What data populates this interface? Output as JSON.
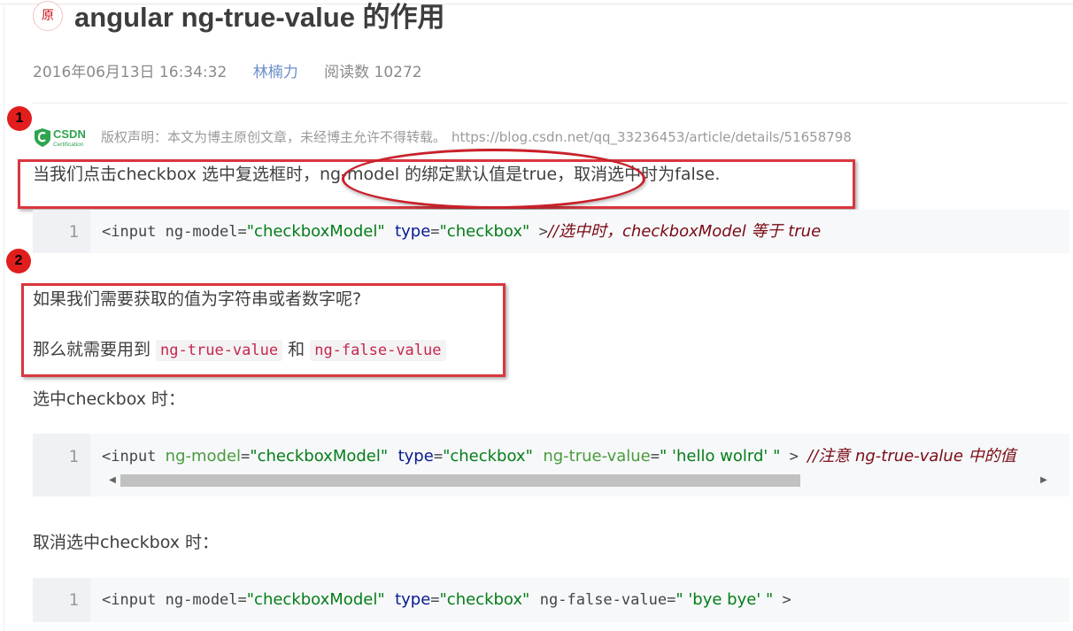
{
  "article": {
    "badge": "原",
    "title": "angular ng-true-value 的作用",
    "date": "2016年06月13日 16:34:32",
    "author": "林楠力",
    "views": "阅读数 10272"
  },
  "annotations": {
    "one": "1",
    "two": "2"
  },
  "copyright": {
    "logo_text": "CSDN",
    "logo_sub": "Certification",
    "text": "版权声明：本文为博主原创文章，未经博主允许不得转载。",
    "url": "https://blog.csdn.net/qq_33236453/article/details/51658798"
  },
  "paragraphs": {
    "p1_before": "当我们点击checkbox 选中复选框时，",
    "p1_highlight": "ng-model 的绑定默认值是true，",
    "p1_after": "取消选中时为false.",
    "p2": "如果我们需要获取的值为字符串或者数字呢?",
    "p3_before": "那么就需要用到 ",
    "p3_code1": "ng-true-value",
    "p3_mid": " 和 ",
    "p3_code2": "ng-false-value",
    "checked_heading": "选中checkbox 时：",
    "unchecked_heading": "取消选中checkbox 时："
  },
  "code_blocks": [
    {
      "line_number": "1",
      "t1": "<input ng-model=",
      "s1": "\"checkboxModel\"",
      "k1": "type",
      "t2": "=",
      "s2": "\"checkbox\"",
      "t3": " >",
      "comment": "//选中时，checkboxModel 等于 true"
    },
    {
      "line_number": "1",
      "t1": "<input ",
      "a1": "ng-model",
      "t2": "=",
      "s1": "\"checkboxModel\"",
      "k1": "type",
      "t3": "=",
      "s2": "\"checkbox\"",
      "a2": "ng-true-value",
      "t4": "=",
      "s3": "\" 'hello wolrd' \"",
      "t5": " > ",
      "comment": "//注意 ng-true-value 中的值"
    },
    {
      "line_number": "1",
      "t1": "<input ng-model=",
      "s1": "\"checkboxModel\"",
      "k1": "type",
      "t2": "=",
      "s2": "\"checkbox\"",
      "a1": "ng-false-value",
      "t3": "=",
      "s3": "\" 'bye bye' \"",
      "t4": " >"
    }
  ],
  "scrollbar": {
    "left_arrow": "◀",
    "right_arrow": "▶",
    "position": 0.0
  },
  "colors": {
    "annotation_red": "#e21d1d",
    "box_red": "#d9363e",
    "author_blue": "#6b8ec9",
    "code_string": "#067d17",
    "code_comment": "#7a0a14"
  }
}
